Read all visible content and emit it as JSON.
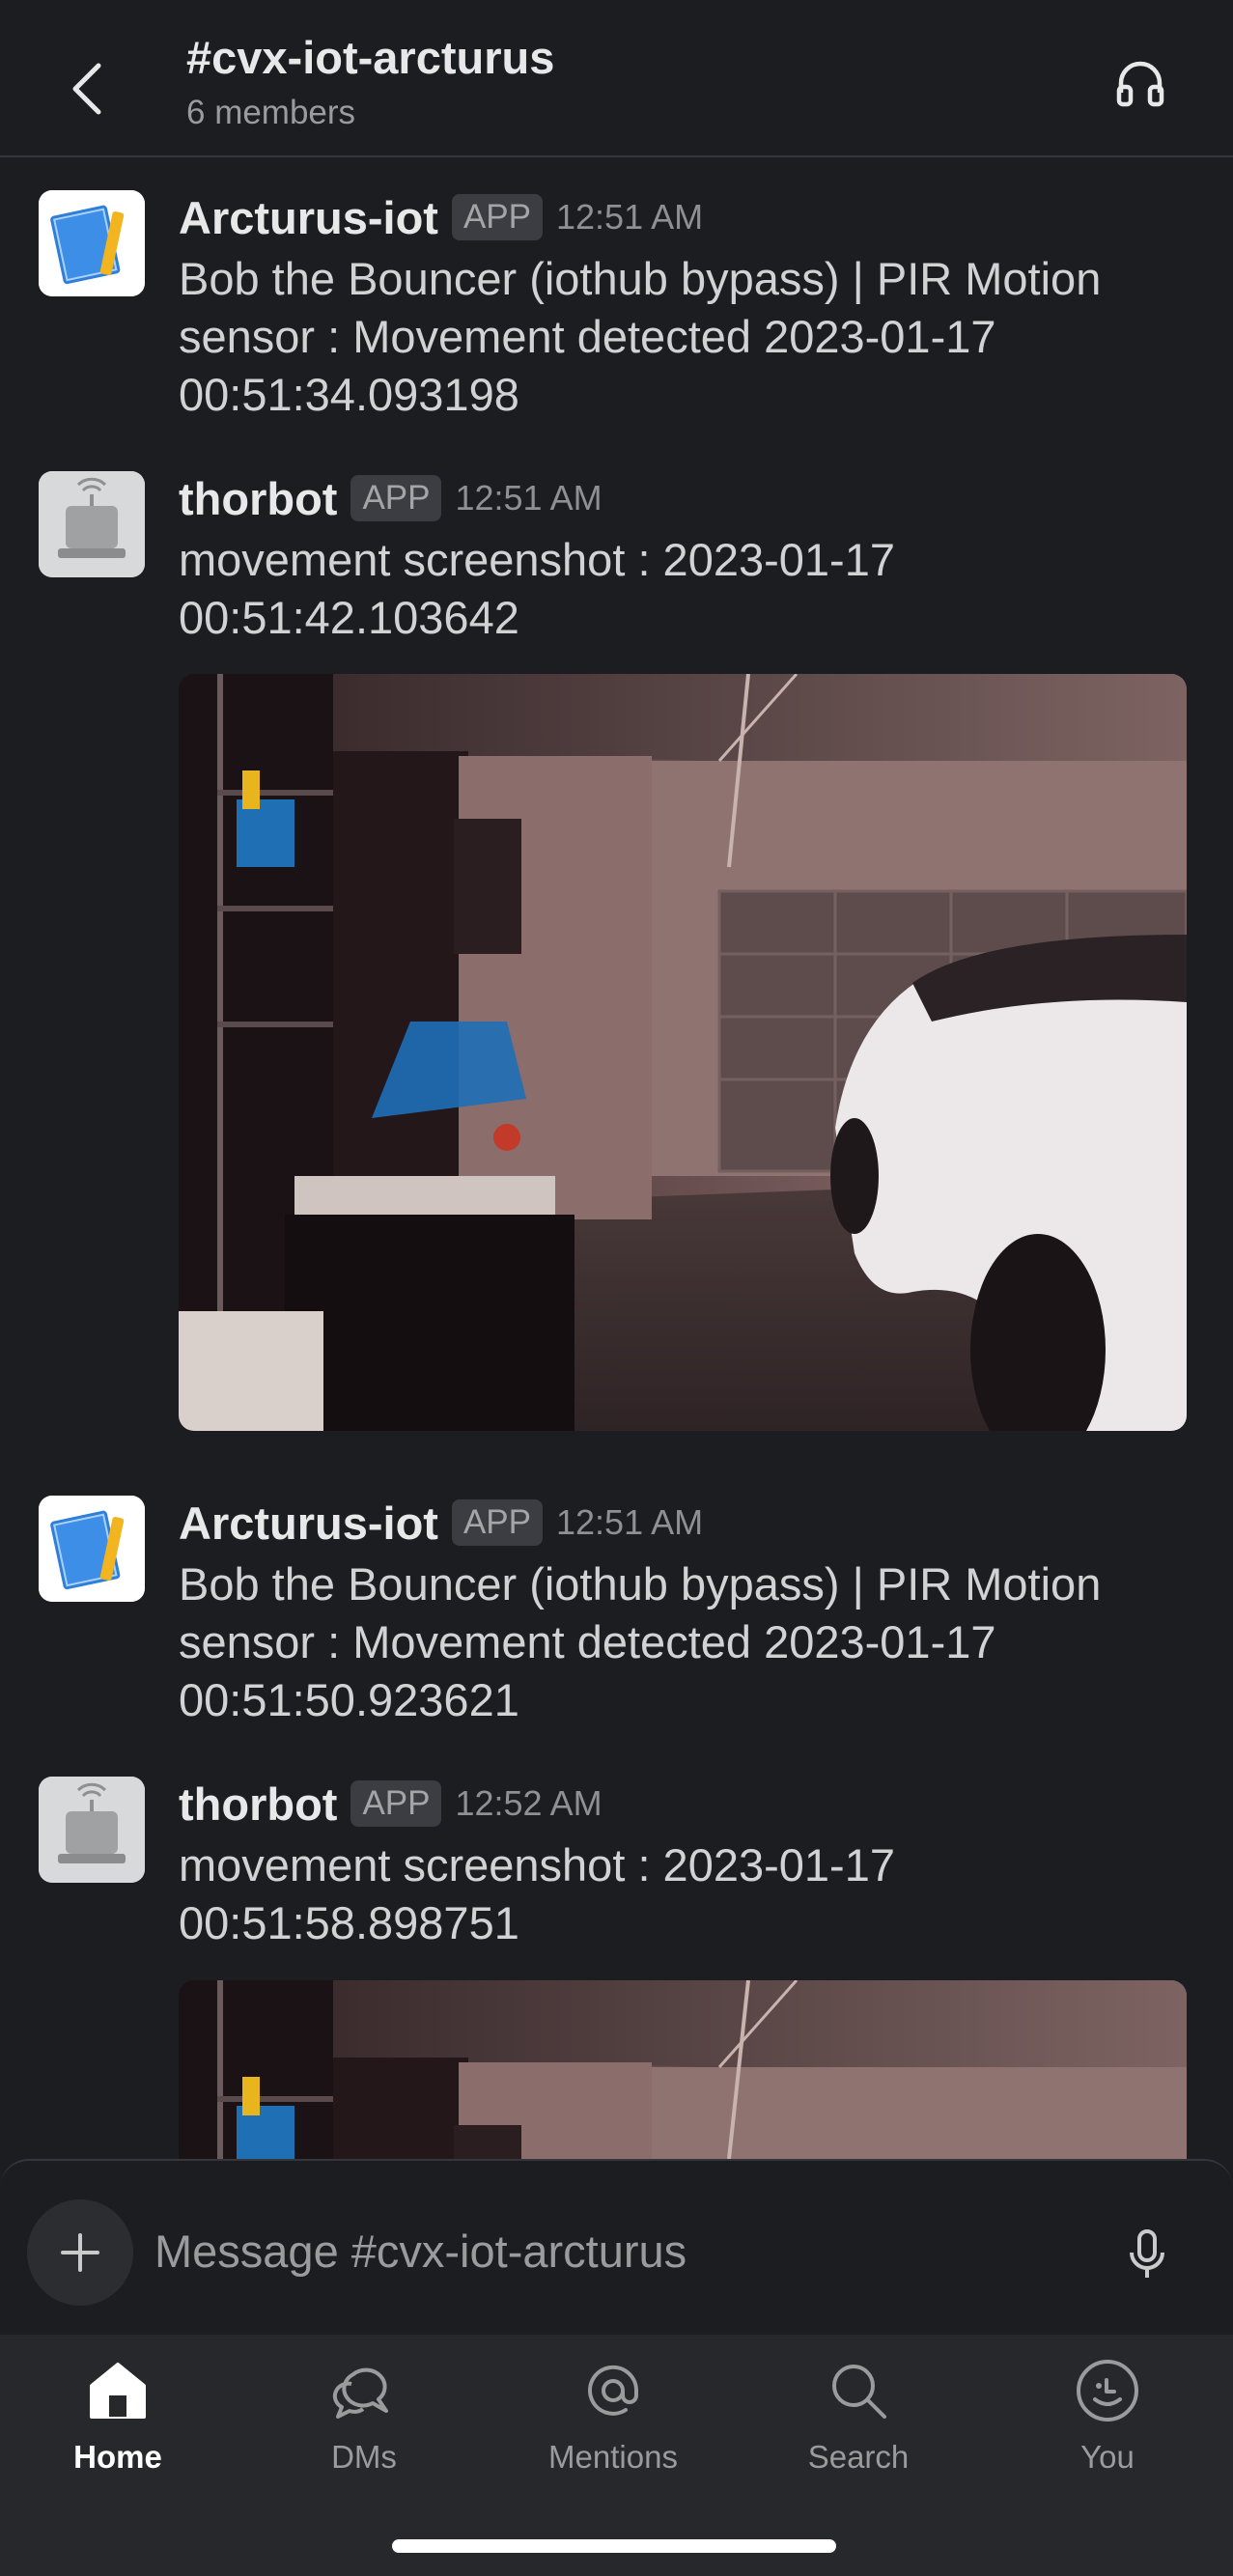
{
  "header": {
    "channel": "#cvx-iot-arcturus",
    "members": "6 members"
  },
  "messages": [
    {
      "sender": "Arcturus-iot",
      "badge": "APP",
      "time": "12:51 AM",
      "text": "Bob the Bouncer (iothub bypass) | PIR Motion sensor : Movement detected 2023-01-17 00:51:34.093198"
    },
    {
      "sender": "thorbot",
      "badge": "APP",
      "time": "12:51 AM",
      "text": "movement screenshot : 2023-01-17 00:51:42.103642"
    },
    {
      "sender": "Arcturus-iot",
      "badge": "APP",
      "time": "12:51 AM",
      "text": "Bob the Bouncer (iothub bypass) | PIR Motion sensor : Movement detected 2023-01-17 00:51:50.923621"
    },
    {
      "sender": "thorbot",
      "badge": "APP",
      "time": "12:52 AM",
      "text": "movement screenshot : 2023-01-17 00:51:58.898751"
    }
  ],
  "composer": {
    "placeholder": "Message #cvx-iot-arcturus"
  },
  "tabs": [
    {
      "label": "Home",
      "icon": "home-icon",
      "active": true
    },
    {
      "label": "DMs",
      "icon": "dms-icon",
      "active": false
    },
    {
      "label": "Mentions",
      "icon": "mentions-icon",
      "active": false
    },
    {
      "label": "Search",
      "icon": "search-icon",
      "active": false
    },
    {
      "label": "You",
      "icon": "you-icon",
      "active": false
    }
  ],
  "colors": {
    "background": "#1b1d21",
    "tabbar": "#26282c",
    "badge": "#3b3d42",
    "text": "#d1d2d3"
  }
}
